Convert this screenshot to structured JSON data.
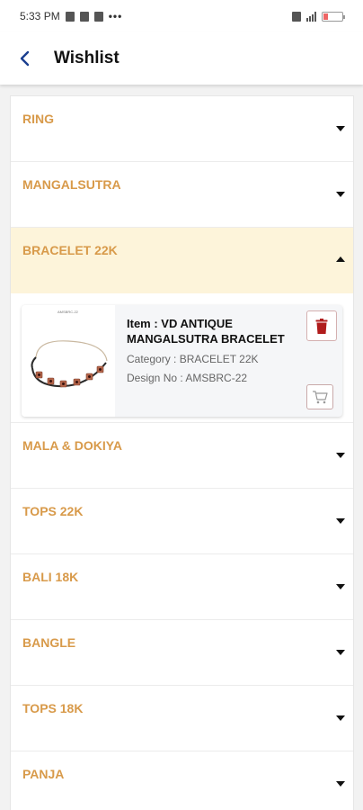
{
  "status_bar": {
    "time": "5:33 PM",
    "left_icons": [
      "trash-notification-icon",
      "trash-notification-icon",
      "vpn-key-icon"
    ],
    "more": "•••",
    "right_icons": [
      "sim-icon",
      "signal-icon",
      "battery-icon"
    ],
    "battery_level": 0.25
  },
  "app_bar": {
    "back_icon": "chevron-left-icon",
    "title": "Wishlist"
  },
  "categories_before": [
    {
      "label": "RING"
    },
    {
      "label": "MANGALSUTRA"
    }
  ],
  "expanded_category": {
    "label": "BRACELET 22K",
    "item": {
      "image_label": "AMSBRC-22",
      "name": "Item : VD ANTIQUE MANGALSUTRA BRACELET",
      "category": "Category : BRACELET 22K",
      "design_no": "Design No : AMSBRC-22",
      "delete_icon": "trash-icon",
      "cart_icon": "cart-icon"
    }
  },
  "categories_after": [
    {
      "label": "MALA & DOKIYA"
    },
    {
      "label": "TOPS 22K"
    },
    {
      "label": "BALI 18K"
    },
    {
      "label": "BANGLE"
    },
    {
      "label": "TOPS 18K"
    },
    {
      "label": "PANJA"
    }
  ],
  "colors": {
    "category_text": "#d89a4a",
    "expanded_bg": "#fdf4da",
    "back_icon": "#1a3f8f",
    "delete_icon": "#b01c1c"
  }
}
